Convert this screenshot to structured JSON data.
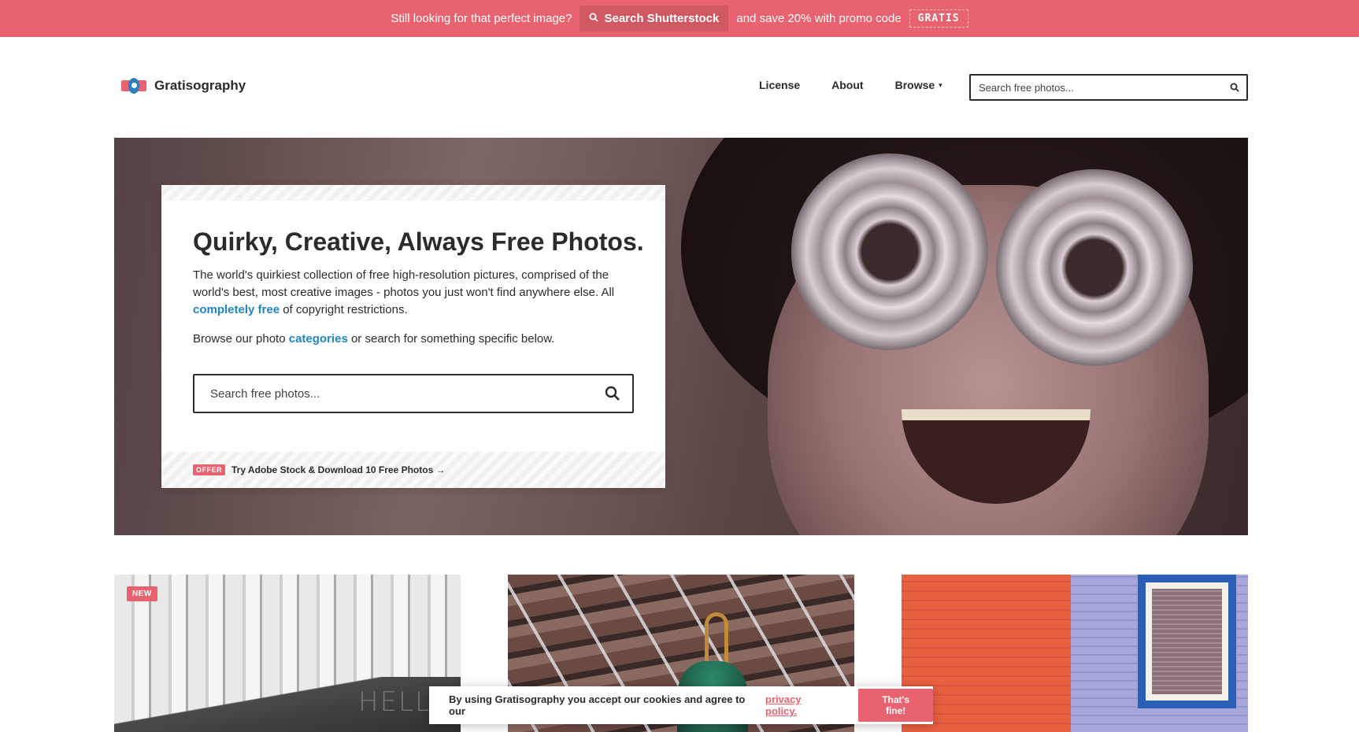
{
  "promo_bar": {
    "lead_text": "Still looking for that perfect image?",
    "button_label": "Search Shutterstock",
    "trail_text": "and save 20% with promo code",
    "promo_code": "GRATIS",
    "color": "#e8636f"
  },
  "header": {
    "logo_text": "Gratisography",
    "nav": [
      {
        "label": "License"
      },
      {
        "label": "About"
      },
      {
        "label": "Browse"
      }
    ],
    "search_placeholder": "Search free photos..."
  },
  "hero": {
    "title": "Quirky, Creative, Always Free Photos.",
    "desc_before": "The world's quirkiest collection of free high-resolution pictures, comprised of the world's best, most creative images - photos you just won't find anywhere else. All",
    "desc_link": "completely free",
    "desc_after": "of copyright restrictions.",
    "browse_before": "Browse our photo",
    "browse_link": "categories",
    "browse_after": "or search for something specific below.",
    "search_placeholder": "Search free photos...",
    "offer_badge": "OFFER",
    "offer_link": "Try Adobe Stock & Download 10 Free Photos →"
  },
  "thumbnails": [
    {
      "badge": "NEW",
      "overlay_text": "HELLO"
    },
    {
      "badge": "",
      "overlay_text": ""
    },
    {
      "badge": "",
      "overlay_text": ""
    }
  ],
  "cookie_banner": {
    "text": "By using Gratisography you accept our cookies and agree to our",
    "link": "privacy policy.",
    "button_label": "That's fine!"
  },
  "colors": {
    "accent": "#e8636f",
    "link": "#1f85c7",
    "text": "#2b2b2b"
  },
  "icons": [
    "search-icon",
    "logo-icon",
    "caret-down-icon"
  ]
}
